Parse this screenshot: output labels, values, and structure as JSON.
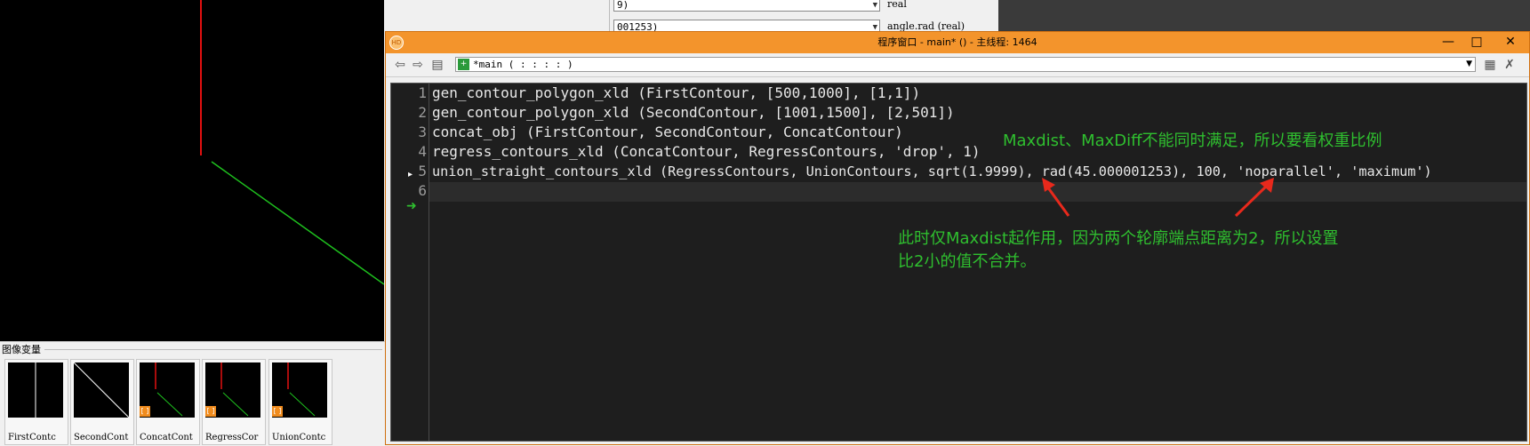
{
  "program_window": {
    "title": "程序窗口 - main* () - 主线程: 1464",
    "procedure_selector": "*main ( : : : : )",
    "buttons": {
      "minimize": "—",
      "maximize": "□",
      "close": "✕"
    }
  },
  "code_lines": [
    {
      "num": "1",
      "text": "gen_contour_polygon_xld (FirstContour, [500,1000], [1,1])"
    },
    {
      "num": "2",
      "text": "gen_contour_polygon_xld (SecondContour, [1001,1500], [2,501])"
    },
    {
      "num": "3",
      "text": "concat_obj (FirstContour, SecondContour, ConcatContour)"
    },
    {
      "num": "4",
      "text": "regress_contours_xld (ConcatContour, RegressContours, 'drop', 1)"
    },
    {
      "num": "5",
      "text": "union_straight_contours_xld (RegressContours, UnionContours, sqrt(1.9999), rad(45.000001253), 100, 'noparallel', 'maximum')"
    },
    {
      "num": "6",
      "text": ""
    }
  ],
  "annotations": {
    "top": "Maxdist、MaxDiff不能同时满足，所以要看权重比例",
    "bottom_line1": "此时仅Maxdist起作用，因为两个轮廓端点距离为2，所以设置",
    "bottom_line2": "比2小的值不合并。"
  },
  "variable_rows": [
    {
      "value": "9)",
      "label": "real"
    },
    {
      "value": "001253)",
      "label": "angle.rad (real)"
    }
  ],
  "image_panel": {
    "title": "图像变量",
    "thumbnails": [
      "FirstContc",
      "SecondCont",
      "ConcatCont",
      "RegressCor",
      "UnionContc"
    ]
  },
  "colors": {
    "accent": "#f3942c",
    "editor_bg": "#1e1e1e",
    "annotation": "#2fbf2f",
    "arrow": "#e8291c"
  }
}
